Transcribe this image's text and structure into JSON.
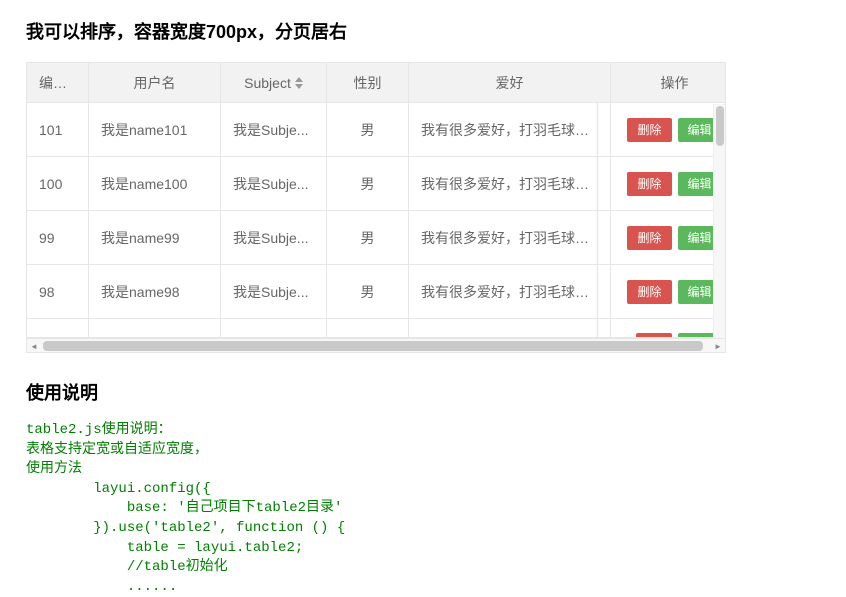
{
  "title": "我可以排序，容器宽度700px，分页居右",
  "table": {
    "headers": {
      "id": "编号...",
      "name": "用户名",
      "subject": "Subject",
      "sex": "性别",
      "hobby": "爱好",
      "op": "操作"
    },
    "rows": [
      {
        "id": "101",
        "name": "我是name101",
        "subject": "我是Subje...",
        "sex": "男",
        "hobby": "我有很多爱好，打羽毛球，打..."
      },
      {
        "id": "100",
        "name": "我是name100",
        "subject": "我是Subje...",
        "sex": "男",
        "hobby": "我有很多爱好，打羽毛球，打..."
      },
      {
        "id": "99",
        "name": "我是name99",
        "subject": "我是Subje...",
        "sex": "男",
        "hobby": "我有很多爱好，打羽毛球，打..."
      },
      {
        "id": "98",
        "name": "我是name98",
        "subject": "我是Subje...",
        "sex": "男",
        "hobby": "我有很多爱好，打羽毛球，打..."
      }
    ],
    "buttons": {
      "delete": "删除",
      "edit": "编辑"
    }
  },
  "usage_title": "使用说明",
  "code": "table2.js使用说明：\n表格支持定宽或自适应宽度，\n使用方法\n        layui.config({\n            base: '自己项目下table2目录'\n        }).use('table2', function () {\n            table = layui.table2;\n            //table初始化\n            ......"
}
